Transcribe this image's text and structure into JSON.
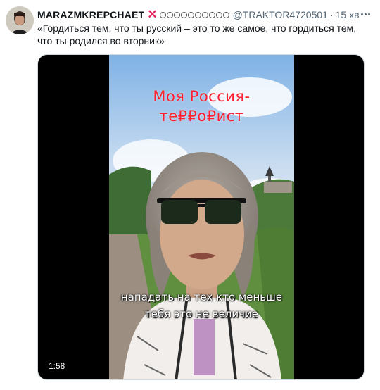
{
  "tweet": {
    "display_name": "MARAZMKREPCHAET",
    "name_emoji_icons": [
      "cross-mark-icon",
      "symbol-icon"
    ],
    "handle": "@TRAKTOR4720501",
    "separator": "·",
    "time": "15 хв",
    "text": "«Гордиться тем, что ты русский – это то же самое, что гордиться тем, что ты родился во вторник»"
  },
  "video": {
    "overlay_line1": "Моя Россия-",
    "overlay_line2": "те₽₽о₽ист",
    "subtitle_line1": "нападать на тех кто меньше",
    "subtitle_line2": "тебя это не величие",
    "duration": "1:58"
  },
  "colors": {
    "text": "#0f1419",
    "secondary": "#536471",
    "overlay_red": "#ff1f2e",
    "cross_red": "#e0245e",
    "media_bg": "#000000"
  }
}
